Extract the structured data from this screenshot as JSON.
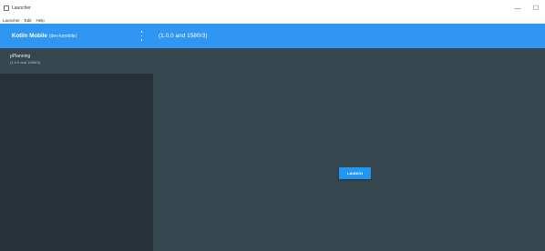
{
  "window": {
    "title": "Launcher",
    "minimize_glyph": "—",
    "maximize_glyph": "☐"
  },
  "menubar": {
    "items": [
      "Launcher",
      "Edit",
      "Help"
    ]
  },
  "sidebar": {
    "header_name": "Kotlin Mobile",
    "header_sub": "(dev-kmobile)",
    "items": [
      {
        "primary": "pPlanning",
        "secondary": "(1.0.0 and 1580r3)"
      }
    ]
  },
  "main": {
    "header_title": "(1.0.0 and 1580r3)",
    "launch_label": "LAUNCH"
  },
  "colors": {
    "accent": "#2f96f3",
    "sidebar_bg": "#263238",
    "main_bg": "#37474f"
  }
}
